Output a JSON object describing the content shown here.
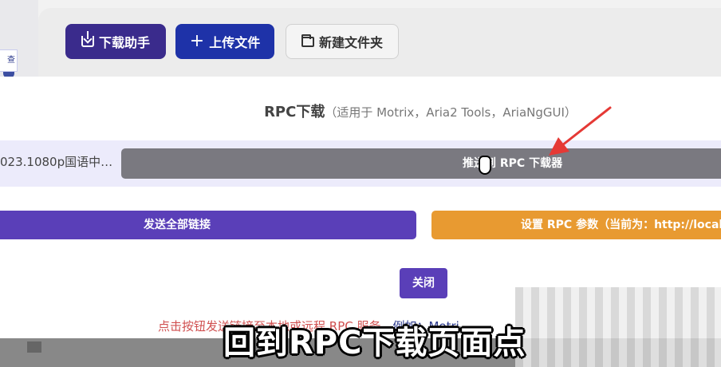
{
  "toolbar": {
    "download_helper_label": "下载助手",
    "upload_label": "上传文件",
    "new_folder_label": "新建文件夹"
  },
  "sidebar": {
    "tag_text": "查看"
  },
  "modal": {
    "title_main": "RPC下载",
    "title_sub": "（适用于 Motrix，Aria2 Tools，AriaNgGUI）",
    "file_name": "023.1080p国语中…",
    "push_button_label": "推送到 RPC 下载器",
    "send_all_label": "发送全部链接",
    "rpc_settings_label": "设置 RPC 参数（当前为：http://localho",
    "close_label": "关闭",
    "hint_text": "点击按钮发送链接至本地或远程 RPC 服务，",
    "hint_example": "例如：Motri"
  },
  "overlay": {
    "subtitle": "回到RPC下载页面点"
  },
  "colors": {
    "accent_purple": "#5a3fb8",
    "accent_orange": "#e89a31",
    "arrow_red": "#e53935",
    "hint_red": "#d05050"
  },
  "icons": {
    "download_helper": "download-icon",
    "upload": "plus-icon",
    "new_folder": "folder-icon"
  }
}
